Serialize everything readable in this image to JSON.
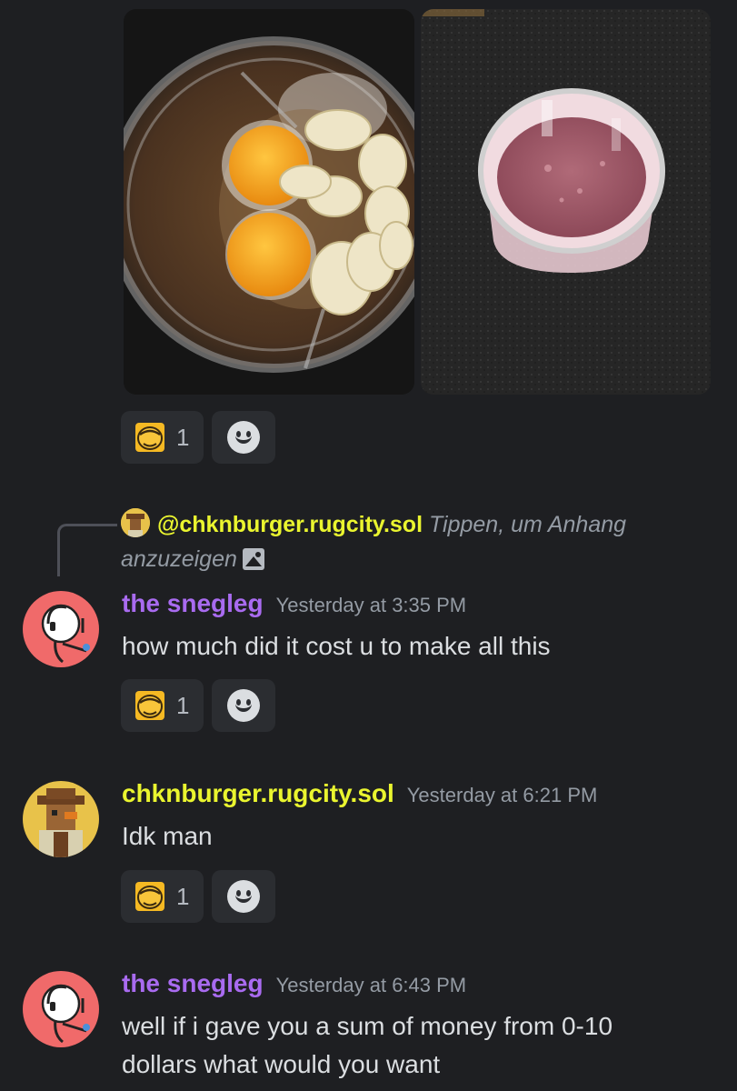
{
  "colors": {
    "background": "#1e1f22",
    "reaction_bg": "#2b2d31",
    "purple_username": "#a96bf0",
    "yellow_username": "#eaf52f",
    "timestamp": "#949ba4",
    "text": "#dbdee1"
  },
  "attachments": {
    "image1_desc": "eggs-and-bananas-in-blender-photo",
    "image2_desc": "pink-smoothie-in-blender-photo"
  },
  "reactions": {
    "r1": {
      "emoji": "pepe-emoji",
      "count": "1"
    },
    "r2": {
      "emoji": "pepe-emoji",
      "count": "1"
    },
    "r3": {
      "emoji": "pepe-emoji",
      "count": "1"
    }
  },
  "reply": {
    "mention": "@chknburger.rugcity.sol",
    "hint": "Tippen, um Anhang anzuzeigen",
    "icon": "image-icon"
  },
  "messages": [
    {
      "author": "the snegleg",
      "timestamp": "Yesterday at 3:35 PM",
      "text": "how much did it cost u to make all this"
    },
    {
      "author": "chknburger.rugcity.sol",
      "timestamp": "Yesterday at 6:21 PM",
      "text": "Idk man"
    },
    {
      "author": "the snegleg",
      "timestamp": "Yesterday at 6:43 PM",
      "text_line1": "well if i gave you a sum of money from 0-10",
      "text_line2": "dollars what would you want"
    }
  ]
}
